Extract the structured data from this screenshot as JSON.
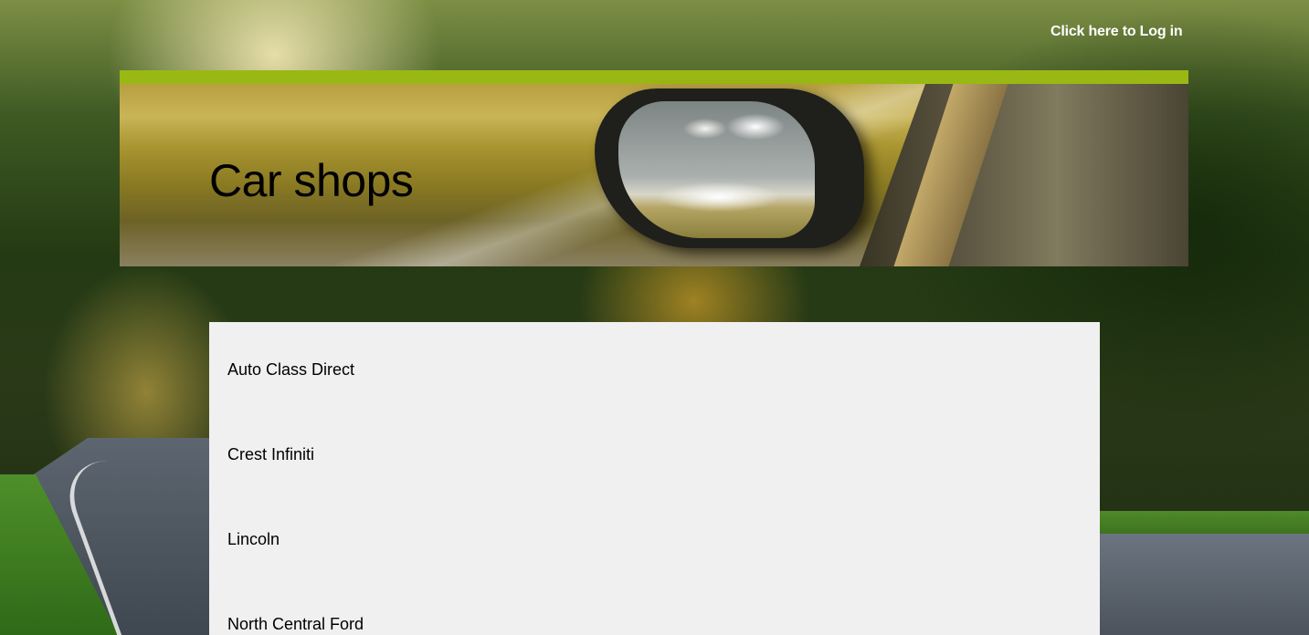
{
  "header": {
    "login_link": "Click here to Log in"
  },
  "banner": {
    "title": "Car shops",
    "accent_color": "#9ab814"
  },
  "shops": [
    "Auto Class Direct",
    "Crest Infiniti",
    "Lincoln",
    "North Central Ford"
  ]
}
